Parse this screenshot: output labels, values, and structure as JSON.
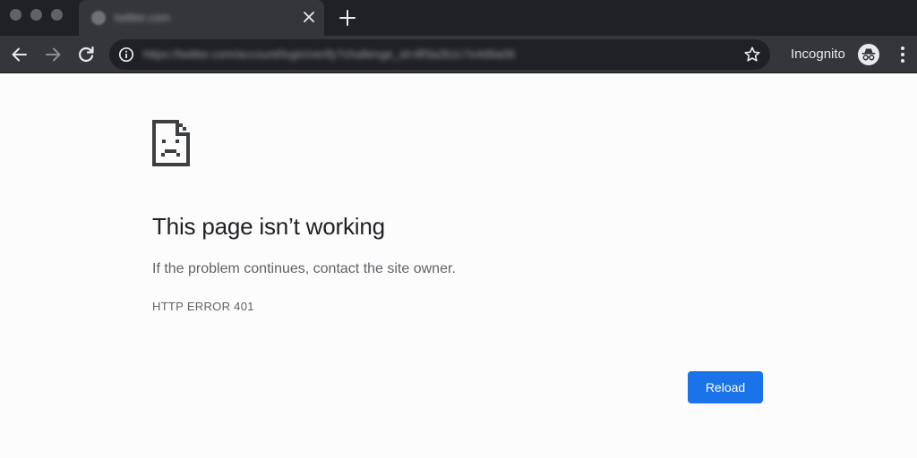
{
  "window": {
    "traffic_lights": [
      "close",
      "minimize",
      "zoom"
    ]
  },
  "tab": {
    "title": "twitter.com",
    "favicon": "globe-icon",
    "close_icon": "close-icon"
  },
  "new_tab": {
    "icon": "plus-icon"
  },
  "toolbar": {
    "back_icon": "arrow-left-icon",
    "forward_icon": "arrow-right-icon",
    "reload_icon": "reload-icon",
    "site_info_icon": "info-icon",
    "url": "https://twitter.com/account/login/verify?challenge_id=8f3a2b1c7e4d9a06",
    "bookmark_icon": "star-icon",
    "profile_label": "Incognito",
    "profile_icon": "incognito-icon",
    "menu_icon": "kebab-menu-icon"
  },
  "page": {
    "icon": "sad-page-icon",
    "heading": "This page isn’t working",
    "message": "If the problem continues, contact the site owner.",
    "error_code": "HTTP ERROR 401",
    "reload_label": "Reload"
  },
  "colors": {
    "tab_strip": "#202124",
    "toolbar": "#35363a",
    "omnibox": "#202124",
    "page_background": "#fcfcfc",
    "accent": "#1a73e8"
  }
}
